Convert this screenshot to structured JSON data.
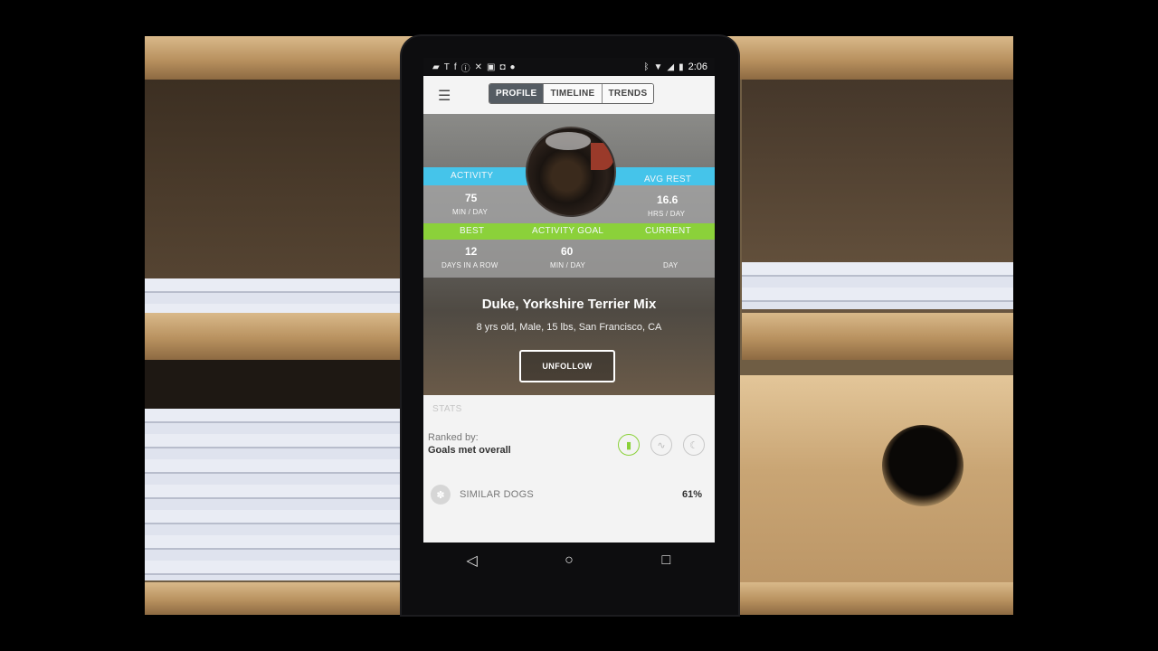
{
  "status_bar": {
    "left_icons": [
      "notification-icon",
      "text-icon",
      "facebook-icon",
      "info-icon",
      "tools-icon",
      "photos-icon",
      "camera-icon",
      "android-icon"
    ],
    "right_icons": [
      "bluetooth-icon",
      "wifi-icon",
      "signal-icon",
      "battery-icon"
    ],
    "time": "2:06"
  },
  "app_bar": {
    "tabs": [
      {
        "label": "PROFILE",
        "active": true
      },
      {
        "label": "TIMELINE",
        "active": false
      },
      {
        "label": "TRENDS",
        "active": false
      }
    ]
  },
  "metrics": {
    "activity": {
      "label": "ACTIVITY",
      "value": "75",
      "unit": "MIN / DAY"
    },
    "avg_rest": {
      "label": "AVG REST",
      "value": "16.6",
      "unit": "HRS / DAY"
    },
    "best": {
      "label": "BEST",
      "value": "12",
      "unit": "DAYS IN A ROW"
    },
    "activity_goal": {
      "label": "ACTIVITY GOAL",
      "value": "60",
      "unit": "MIN / DAY"
    },
    "current": {
      "label": "CURRENT",
      "value": "",
      "unit": "DAY"
    }
  },
  "profile": {
    "name": "Duke, Yorkshire Terrier Mix",
    "info": "8 yrs old, Male, 15 lbs, San Francisco, CA",
    "unfollow_label": "UNFOLLOW"
  },
  "stats": {
    "header": "STATS",
    "ranked_label": "Ranked by:",
    "ranked_value": "Goals met overall",
    "similar_label": "SIMILAR DOGS",
    "similar_pct": "61%"
  },
  "colors": {
    "activity_band": "#45c4ea",
    "goal_band": "#8bd13a",
    "tab_active": "#555c63"
  }
}
